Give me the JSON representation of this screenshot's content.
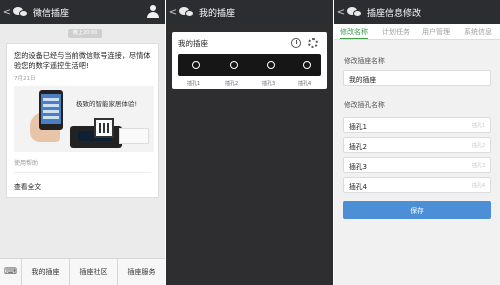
{
  "screen1": {
    "title": "微信插座",
    "time_badge": "晚上20:00",
    "message": "您的设备已经与当前微信账号连接，尽情体验您的数字遥控生活吧!",
    "date": "7月21日",
    "promo_text": "极致的智能家居体验!",
    "help": "使用帮助",
    "read_more": "查看全文",
    "menu": [
      "我的插座",
      "插座社区",
      "插座服务"
    ]
  },
  "screen2": {
    "title": "我的插座",
    "card_title": "我的插座",
    "slots": [
      "插孔1",
      "插孔2",
      "插孔3",
      "插孔4"
    ]
  },
  "screen3": {
    "title": "插座信息修改",
    "tabs": [
      "修改名称",
      "计划任务",
      "用户管理",
      "系统信息"
    ],
    "active_tab": "修改名称",
    "socket_name_label": "修改插座名称",
    "socket_name_value": "我的插座",
    "slot_name_label": "修改插孔名称",
    "slots": [
      {
        "name": "插孔1",
        "placeholder": "插孔1"
      },
      {
        "name": "插孔2",
        "placeholder": "插孔2"
      },
      {
        "name": "插孔3",
        "placeholder": "插孔3"
      },
      {
        "name": "插孔4",
        "placeholder": "插孔4"
      }
    ],
    "save": "保存"
  },
  "colors": {
    "topbar": "#2c2d31",
    "accent_green": "#3f9e4b",
    "save_blue": "#4d8fd6"
  }
}
